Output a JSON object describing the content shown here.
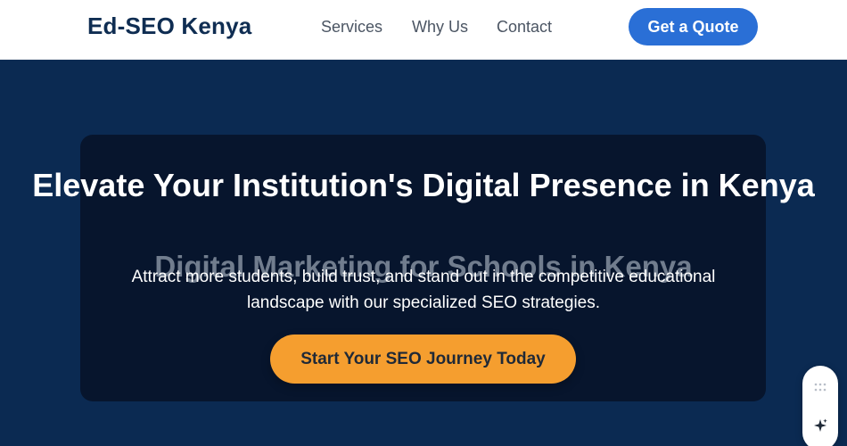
{
  "nav": {
    "brand": "Ed-SEO Kenya",
    "links": [
      "Services",
      "Why Us",
      "Contact"
    ],
    "quote_button": "Get a Quote"
  },
  "hero": {
    "title": "Elevate Your Institution's Digital Presence in Kenya",
    "ghost_heading": "Digital Marketing for Schools in Kenya",
    "description": "Attract more students, build trust, and stand out in the competitive educational landscape with our specialized SEO strategies.",
    "cta": "Start Your SEO Journey Today"
  },
  "widget": {
    "icons": [
      "grip-icon",
      "sparkle-icon"
    ]
  },
  "colors": {
    "brand_text": "#0f2d52",
    "primary": "#2a6fd6",
    "hero_bg": "#0b2a52",
    "card_bg": "#071228",
    "accent": "#f59e2f"
  }
}
